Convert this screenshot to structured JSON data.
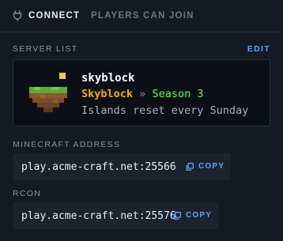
{
  "header": {
    "tabs": [
      {
        "label": "CONNECT",
        "active": true,
        "icon": "plug-icon"
      },
      {
        "label": "PLAYERS CAN JOIN",
        "active": false
      }
    ]
  },
  "server_list": {
    "label": "SERVER LIST",
    "edit_label": "EDIT",
    "server": {
      "name": "skyblock",
      "icon": "grass-island-icon",
      "motd_line1": {
        "part1": "Skyblock",
        "separator": "»",
        "part2": "Season 3"
      },
      "motd_line2": "Islands reset every Sunday"
    }
  },
  "minecraft_address": {
    "label": "MINECRAFT ADDRESS",
    "value": "play.acme-craft.net:25566",
    "copy_label": "COPY"
  },
  "rcon": {
    "label": "RCON",
    "value": "play.acme-craft.net:25576",
    "copy_label": "COPY"
  },
  "colors": {
    "background": "#141a22",
    "accent": "#58a6ff",
    "motd_gold": "#ffaa00",
    "motd_green": "#55ff55"
  }
}
